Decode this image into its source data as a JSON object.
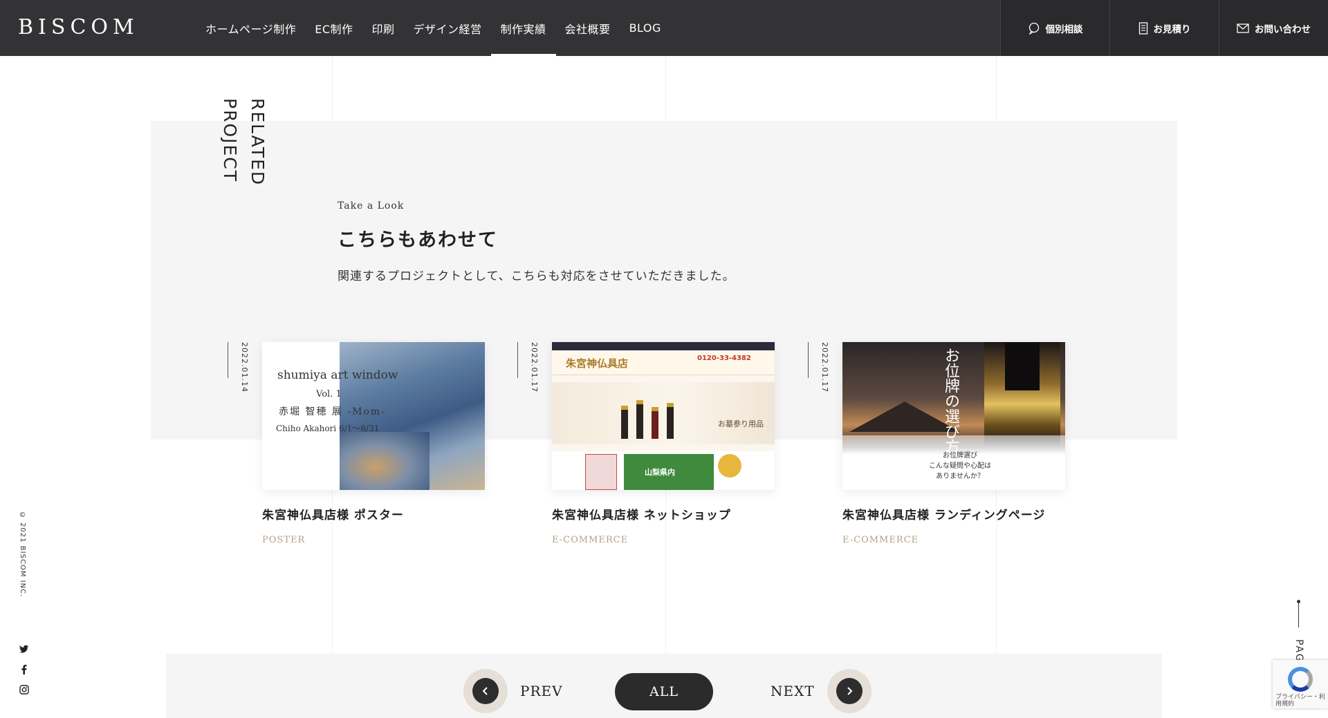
{
  "brand": {
    "logo_text": "BISCOM"
  },
  "nav": {
    "items": [
      {
        "label": "ホームページ制作"
      },
      {
        "label": "EC制作"
      },
      {
        "label": "印刷"
      },
      {
        "label": "デザイン経営"
      },
      {
        "label": "制作実績",
        "active": true
      },
      {
        "label": "会社概要"
      },
      {
        "label": "BLOG"
      }
    ]
  },
  "header_actions": {
    "consult": {
      "label": "個別相談",
      "icon": "chat-bubble-icon"
    },
    "estimate": {
      "label": "お見積り",
      "icon": "document-icon"
    },
    "contact": {
      "label": "お問い合わせ",
      "icon": "mail-icon"
    }
  },
  "related": {
    "vertical_title_line1": "RELATED",
    "vertical_title_line2": "PROJECT",
    "eyebrow": "Take a Look",
    "heading": "こちらもあわせて",
    "lead": "関連するプロジェクトとして、こちらも対応をさせていただきました。",
    "cards": [
      {
        "date": "2022.01.14",
        "title": "朱宮神仏具店様 ポスター",
        "category": "POSTER",
        "thumb_text": {
          "line1": "shumiya art window",
          "line2": "Vol. 1",
          "line3": "赤堀 智穂 展 -Mom-",
          "line4": "Chiho Akahori 6/1～8/31"
        }
      },
      {
        "date": "2022.01.17",
        "title": "朱宮神仏具店様 ネットショップ",
        "category": "E-COMMERCE",
        "thumb_text": {
          "shop": "朱宮神仏具店",
          "phone": "0120-33-4382",
          "badge": "山梨県内",
          "tag": "お墓参り用品"
        }
      },
      {
        "date": "2022.01.17",
        "title": "朱宮神仏具店様 ランディングページ",
        "category": "E-COMMERCE",
        "thumb_text": {
          "big": "お位牌の選び方",
          "sub1": "お位牌選び",
          "sub2": "こんな疑問や心配は",
          "sub3": "ありませんか？"
        }
      }
    ]
  },
  "footer": {
    "copyright": "© 2021 BISCOM INC.",
    "social": [
      "twitter-icon",
      "facebook-icon",
      "instagram-icon"
    ],
    "page_top": "PAGE TOP",
    "recaptcha_text": "プライバシー・利用規約"
  },
  "pager": {
    "prev": "PREV",
    "all": "ALL",
    "next": "NEXT"
  }
}
